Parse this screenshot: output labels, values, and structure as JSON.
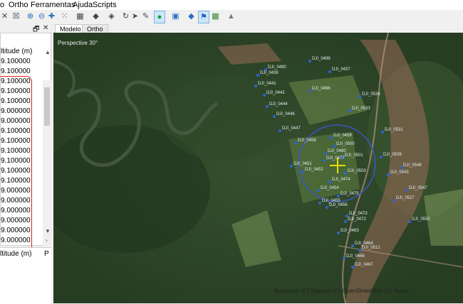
{
  "menu": [
    "o",
    "Ortho",
    "Ferramentas",
    "Ajuda",
    "Scripts"
  ],
  "toolbar_icons": [
    "close-icon",
    "select-icon",
    "zoom-in-icon",
    "zoom-out-icon",
    "pan-icon",
    "points-icon",
    "grid-icon",
    "arrow-icon",
    "move-icon",
    "rotate-icon",
    "cursor-icon",
    "edit-icon",
    "globe-icon",
    "image-icon",
    "layers-icon",
    "flag-icon",
    "photo-icon",
    "terrain-icon"
  ],
  "dock": {
    "title_restore": "🗗",
    "title_close": "✕"
  },
  "tabs": [
    "Modelo",
    "Ortho"
  ],
  "table": {
    "column_header": "ltitude (m)",
    "values": [
      "9.100000",
      "9.100000",
      "9.100000",
      "9.100000",
      "9.100000",
      "9.000000",
      "9.000000",
      "9.100000",
      "9.100000",
      "9.100000",
      "9.100000",
      "9.100000",
      "9.100000",
      "9.000000",
      "9.000000",
      "9.000000",
      "9.000000",
      "9.000000",
      "9.000000"
    ]
  },
  "lower_panel": {
    "column_header": "ltitude (m)",
    "side_label": "P"
  },
  "map": {
    "perspective_label": "Perspective 30°",
    "attribution": "Basemap: (C) Mapbox (C) OpenStreetMap (C) Maxar",
    "cameras": [
      {
        "label": "DJI_0490"
      },
      {
        "label": "DJI_0498"
      },
      {
        "label": "DJI_0439"
      },
      {
        "label": "DJI_0437"
      },
      {
        "label": "DJI_0441"
      },
      {
        "label": "DJI_0442"
      },
      {
        "label": "DJI_0496"
      },
      {
        "label": "DJI_0444"
      },
      {
        "label": "DJI_0446"
      },
      {
        "label": "DJI_0447"
      },
      {
        "label": "DJI_0459"
      },
      {
        "label": "DJI_0458"
      },
      {
        "label": "DJI_0500"
      },
      {
        "label": "DJI_0480"
      },
      {
        "label": "DJI_0501"
      },
      {
        "label": "DJI_0477"
      },
      {
        "label": "DJI_0451"
      },
      {
        "label": "DJI_0452"
      },
      {
        "label": "DJI_0503"
      },
      {
        "label": "DJI_0474"
      },
      {
        "label": "DJI_0454"
      },
      {
        "label": "DJI_0475"
      },
      {
        "label": "DJI_0455"
      },
      {
        "label": "DJI_0456"
      },
      {
        "label": "DJI_0473"
      },
      {
        "label": "DJI_0472"
      },
      {
        "label": "DJI_0463"
      },
      {
        "label": "DJI_0464"
      },
      {
        "label": "DJI_0512"
      },
      {
        "label": "DJI_0466"
      },
      {
        "label": "DJI_0467"
      },
      {
        "label": "DJI_0543"
      },
      {
        "label": "DJI_0539"
      },
      {
        "label": "DJI_0548"
      },
      {
        "label": "DJI_0547"
      },
      {
        "label": "DJI_0527"
      },
      {
        "label": "DJI_0550"
      },
      {
        "label": "DJI_0531"
      },
      {
        "label": "DJI_0533"
      },
      {
        "label": "DJI_0536"
      }
    ]
  },
  "colors": {
    "highlight": "#e0201a",
    "camera_point": "#2f63d6",
    "selection_circle": "#3a55c8",
    "crosshair": "#e8e000"
  }
}
